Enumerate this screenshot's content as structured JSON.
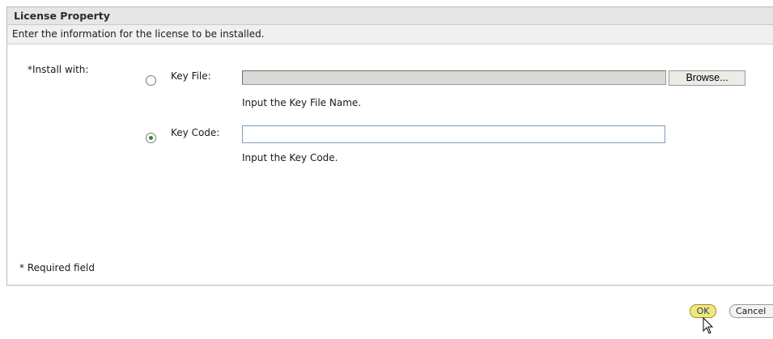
{
  "panel": {
    "title": "License Property",
    "description": "Enter the information for the license to be installed."
  },
  "form": {
    "install_with_label": "*Install with:",
    "key_file": {
      "label": "Key File:",
      "selected": false,
      "value": "",
      "browse_label": "Browse...",
      "hint": "Input the Key File Name."
    },
    "key_code": {
      "label": "Key Code:",
      "selected": true,
      "value": "",
      "hint": "Input the Key Code."
    },
    "required_note": "* Required field"
  },
  "footer": {
    "ok_label": "OK",
    "cancel_label": "Cancel"
  },
  "colors": {
    "ok_button": "#f2e77a",
    "radio_selected": "#2b8a2b",
    "header_bg": "#e6e6e6"
  },
  "icons": [
    "radio-icon",
    "mouse-cursor-icon"
  ]
}
